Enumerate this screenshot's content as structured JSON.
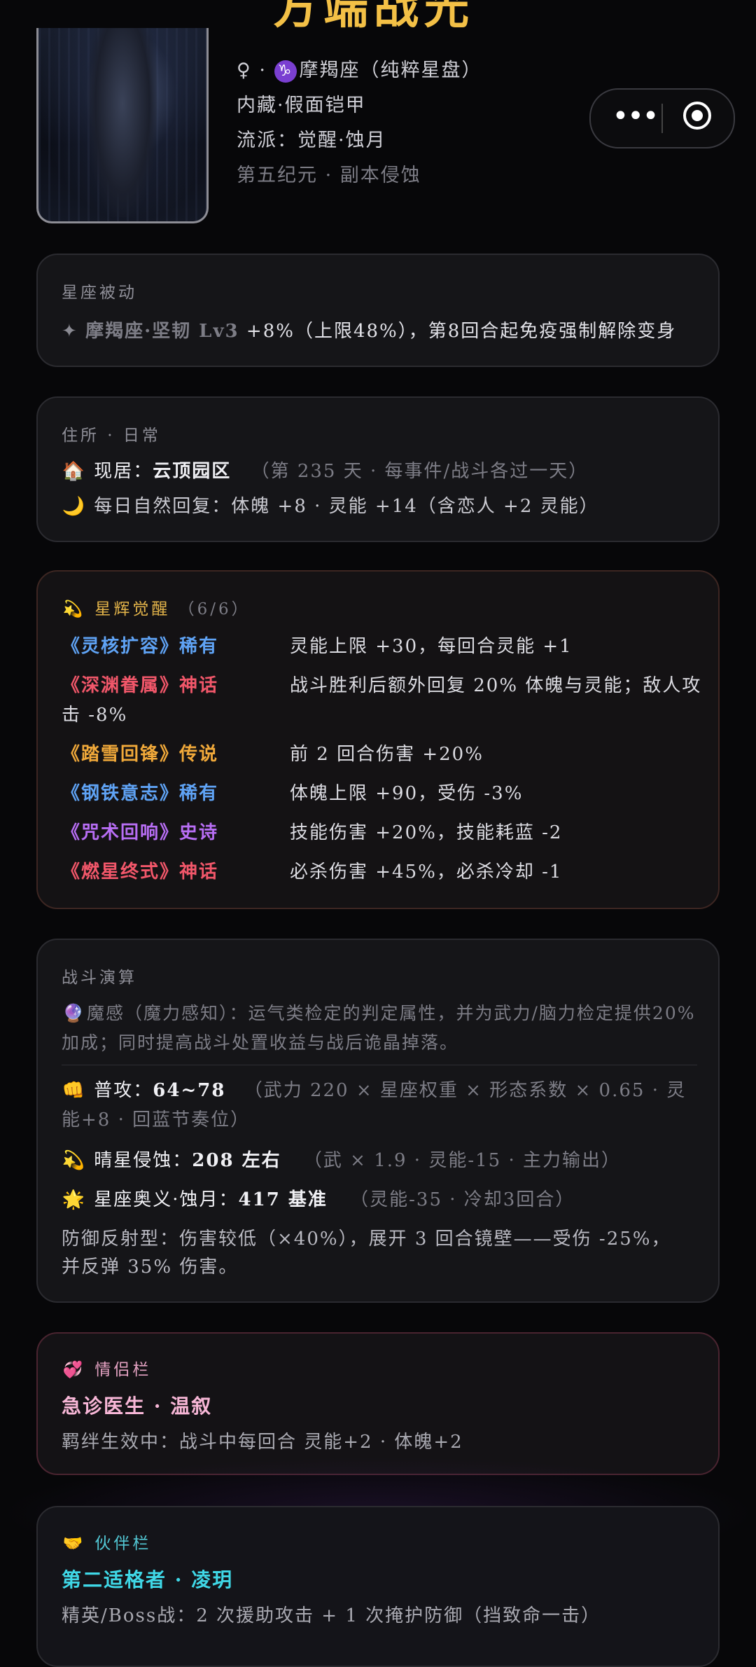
{
  "header": {
    "title_partial": "方端战光",
    "zodiac_symbol": "♑",
    "gender_symbol": "♀",
    "zodiac_line_suffix": "摩羯座（纯粹星盘）",
    "line2": "内藏·假面铠甲",
    "line3": "流派：觉醒·蚀月",
    "line4": "第五纪元 · 副本侵蚀"
  },
  "capsule": {
    "more_icon": "more-dots-icon",
    "close_icon": "target-icon"
  },
  "passive": {
    "label": "星座被动",
    "icon": "four-point-star-icon",
    "name": "摩羯座·坚韧 Lv3",
    "effect": "+8%（上限48%），第8回合起免疫强制解除变身"
  },
  "residence": {
    "label": "住所 · 日常",
    "house_icon": "🏠",
    "current_prefix": "现居：",
    "current_place": "云顶园区",
    "day_note": "（第 235 天 · 每事件/战斗各过一天）",
    "moon_icon": "🌙",
    "recovery": "每日自然回复：体魄 +8 · 灵能 +14（含恋人 +2 灵能）"
  },
  "awakening": {
    "icon": "💫",
    "label": "星辉觉醒",
    "count": "（6/6）",
    "items": [
      {
        "name": "《灵核扩容》稀有",
        "desc": "灵能上限 +30，每回合灵能 +1",
        "rarity": "rare"
      },
      {
        "name": "《深渊眷属》神话",
        "desc": "战斗胜利后额外回复 20% 体魄与灵能；敌人攻",
        "desc2": "击 -8%",
        "rarity": "mythic"
      },
      {
        "name": "《踏雪回锋》传说",
        "desc": "前 2 回合伤害 +20%",
        "rarity": "legend"
      },
      {
        "name": "《钢铁意志》稀有",
        "desc": "体魄上限 +90，受伤 -3%",
        "rarity": "rare"
      },
      {
        "name": "《咒术回响》史诗",
        "desc": "技能伤害 +20%，技能耗蓝 -2",
        "rarity": "epic"
      },
      {
        "name": "《燃星终式》神话",
        "desc": "必杀伤害 +45%，必杀冷却 -1",
        "rarity": "mythic"
      }
    ]
  },
  "combat": {
    "label": "战斗演算",
    "orb_icon": "🔮",
    "perception": "魔感（魔力感知）：运气类检定的判定属性，并为武力/脑力检定提供20% 加成；同时提高战斗处置收益与战后诡晶掉落。",
    "normal_icon": "👊",
    "normal_label": "普攻：",
    "normal_value": "64~78",
    "normal_note": "（武力 220 × 星座权重 × 形态系数 × 0.65 · 灵能+8 ·",
    "normal_note2": "回蓝节奏位）",
    "skill1_icon": "💫",
    "skill1_label": "晴星侵蚀：",
    "skill1_value": "208 左右",
    "skill1_note": "（武 × 1.9 · 灵能-15 · 主力输出）",
    "skill2_icon": "🌟",
    "skill2_label": "星座奥义·蚀月：",
    "skill2_value": "417 基准",
    "skill2_note": "（灵能-35 · 冷却3回合）",
    "defense_line1": "防御反射型：伤害较低（×40%），展开 3 回合镜壁——受伤 -25%，",
    "defense_line2": "并反弹 35% 伤害。"
  },
  "lover": {
    "icon": "💞",
    "label": "情侣栏",
    "name": "急诊医生 · 温叙",
    "bond": "羁绊生效中：战斗中每回合 灵能+2 · 体魄+2"
  },
  "partner": {
    "icon": "🤝",
    "label": "伙伴栏",
    "name": "第二适格者 · 凌玥",
    "desc": "精英/Boss战：2 次援助攻击 + 1 次掩护防御（挡致命一击）"
  },
  "colors": {
    "rare": "#5fa3f5",
    "mythic": "#f2576a",
    "legend": "#f1a93a",
    "epic": "#b86ef5",
    "gold": "#e3b44a",
    "cyan": "#3fd7e6",
    "pink": "#f7b6d6"
  }
}
